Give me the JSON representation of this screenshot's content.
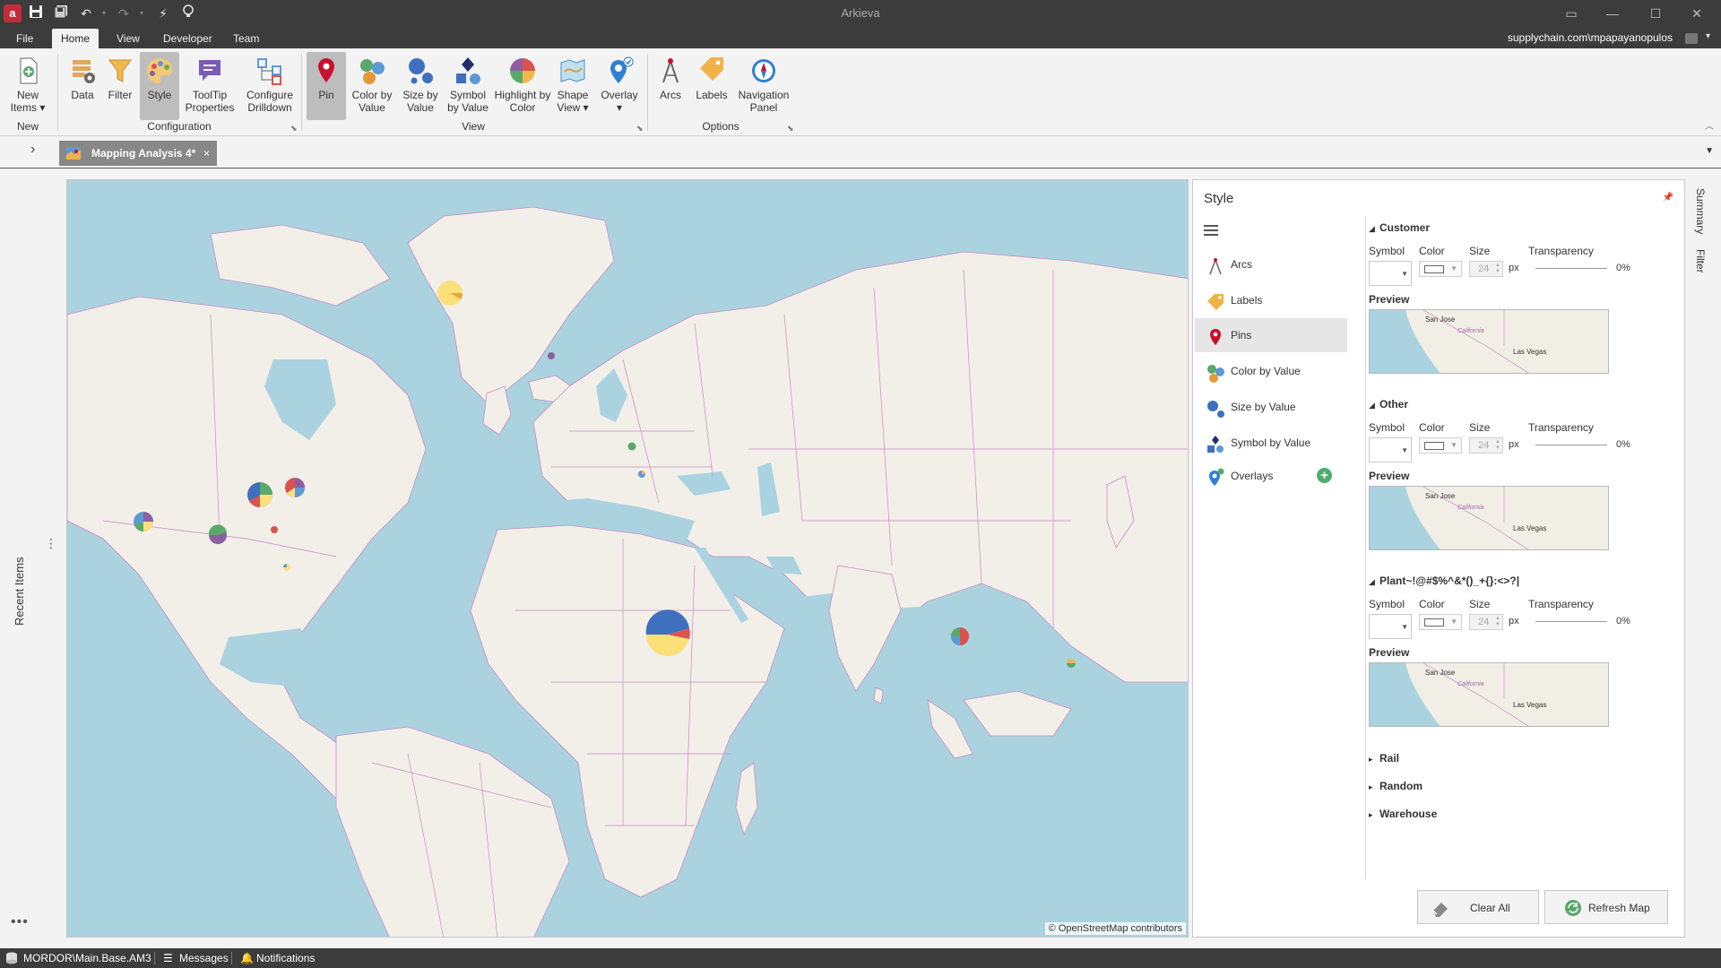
{
  "window": {
    "title": "Arkieva",
    "app_logo": "a",
    "account": "supplychain.com\\mpapayanopulos"
  },
  "quick_access": [
    "save-icon",
    "save-all-icon",
    "undo-icon",
    "redo-icon",
    "lightning-icon",
    "lightbulb-icon"
  ],
  "ribbon_tabs": [
    {
      "label": "File",
      "active": false
    },
    {
      "label": "Home",
      "active": true
    },
    {
      "label": "View",
      "active": false
    },
    {
      "label": "Developer",
      "active": false
    },
    {
      "label": "Team",
      "active": false
    }
  ],
  "ribbon": {
    "new_items": "New Items",
    "data": "Data",
    "filter": "Filter",
    "style": "Style",
    "tooltip": "ToolTip Properties",
    "drilldown": "Configure Drilldown",
    "pin": "Pin",
    "color_by_value": "Color by Value",
    "size_by_value": "Size by Value",
    "symbol_by_value": "Symbol by Value",
    "highlight_by_color": "Highlight by Color",
    "shape_view": "Shape View",
    "overlay": "Overlay",
    "arcs": "Arcs",
    "labels": "Labels",
    "navigation_panel": "Navigation Panel",
    "groups": {
      "new": "New",
      "configuration": "Configuration",
      "view": "View",
      "options": "Options"
    }
  },
  "doc_tab": {
    "label": "Mapping Analysis 4*",
    "close": "×"
  },
  "left_rail": {
    "recent_items": "Recent Items"
  },
  "map": {
    "attribution": "© OpenStreetMap contributors"
  },
  "style_panel": {
    "title": "Style",
    "nav": [
      {
        "label": "Arcs",
        "icon": "arcs-icon"
      },
      {
        "label": "Labels",
        "icon": "tag-icon"
      },
      {
        "label": "Pins",
        "icon": "pin-icon",
        "active": true
      },
      {
        "label": "Color by Value",
        "icon": "color-dots-icon"
      },
      {
        "label": "Size by Value",
        "icon": "size-dots-icon"
      },
      {
        "label": "Symbol by Value",
        "icon": "symbol-shapes-icon"
      },
      {
        "label": "Overlays",
        "icon": "overlay-icon"
      }
    ],
    "field_labels": {
      "symbol": "Symbol",
      "color": "Color",
      "size": "Size",
      "transparency": "Transparency",
      "preview": "Preview",
      "unit": "px"
    },
    "sections": [
      {
        "name": "Customer",
        "size": "24",
        "transparency": "0%"
      },
      {
        "name": "Other",
        "size": "24",
        "transparency": "0%"
      },
      {
        "name": "Plant~!@#$%^&*()_+{}:<>?|",
        "size": "24",
        "transparency": "0%"
      }
    ],
    "preview_labels": {
      "city1": "San Jose",
      "state": "California",
      "city2": "Las Vegas"
    },
    "collapsed_sections": [
      "Rail",
      "Random",
      "Warehouse"
    ],
    "clear_all": "Clear All",
    "refresh_map": "Refresh Map"
  },
  "right_rail": [
    "Summary",
    "Filter"
  ],
  "status_bar": {
    "model": "MORDOR\\Main.Base.AM3",
    "messages": "Messages",
    "notifications": "Notifications"
  },
  "colors": {
    "chrome": "#3c3c3c",
    "sea": "#aad3df",
    "land": "#f2efe9",
    "border": "#c88bc3"
  }
}
